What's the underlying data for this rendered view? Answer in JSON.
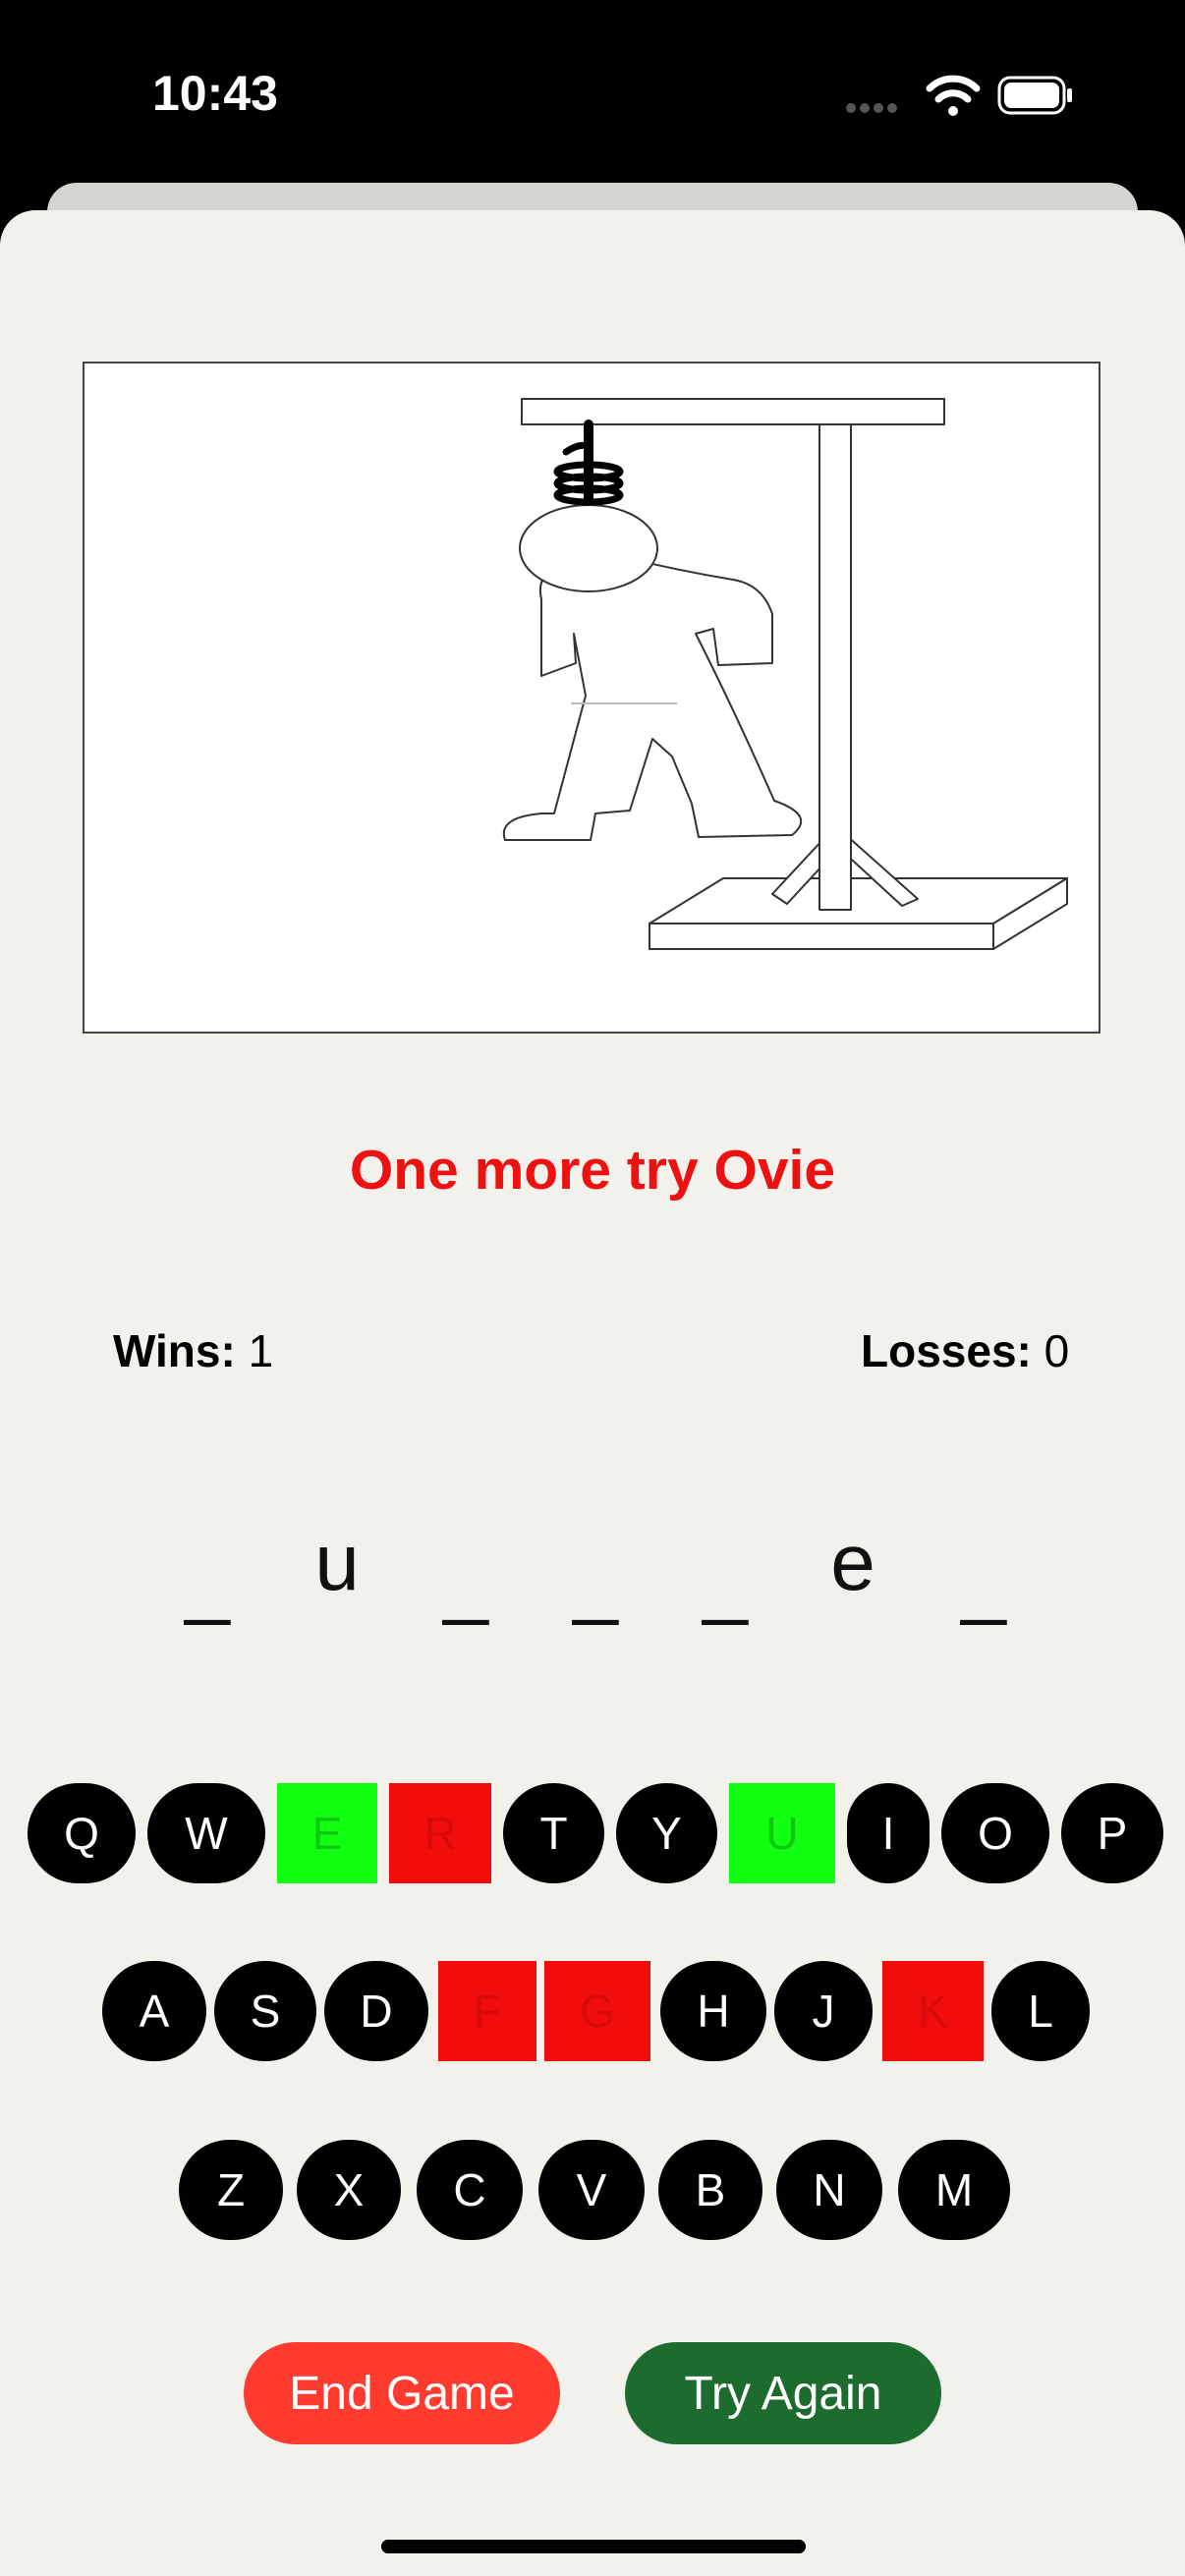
{
  "status_bar": {
    "time": "10:43"
  },
  "game": {
    "message": "One more try Ovie",
    "message_color": "#ee1111",
    "wins_label": "Wins:",
    "wins_value": "1",
    "losses_label": "Losses:",
    "losses_value": "0",
    "word_slots": [
      "_",
      "u",
      "_",
      "_",
      "_",
      "e",
      "_"
    ]
  },
  "keyboard": {
    "rows": [
      [
        {
          "letter": "Q",
          "state": "unused"
        },
        {
          "letter": "W",
          "state": "unused"
        },
        {
          "letter": "E",
          "state": "correct"
        },
        {
          "letter": "R",
          "state": "wrong"
        },
        {
          "letter": "T",
          "state": "unused"
        },
        {
          "letter": "Y",
          "state": "unused"
        },
        {
          "letter": "U",
          "state": "correct"
        },
        {
          "letter": "I",
          "state": "unused"
        },
        {
          "letter": "O",
          "state": "unused"
        },
        {
          "letter": "P",
          "state": "unused"
        }
      ],
      [
        {
          "letter": "A",
          "state": "unused"
        },
        {
          "letter": "S",
          "state": "unused"
        },
        {
          "letter": "D",
          "state": "unused"
        },
        {
          "letter": "F",
          "state": "wrong"
        },
        {
          "letter": "G",
          "state": "wrong"
        },
        {
          "letter": "H",
          "state": "unused"
        },
        {
          "letter": "J",
          "state": "unused"
        },
        {
          "letter": "K",
          "state": "wrong"
        },
        {
          "letter": "L",
          "state": "unused"
        }
      ],
      [
        {
          "letter": "Z",
          "state": "unused"
        },
        {
          "letter": "X",
          "state": "unused"
        },
        {
          "letter": "C",
          "state": "unused"
        },
        {
          "letter": "V",
          "state": "unused"
        },
        {
          "letter": "B",
          "state": "unused"
        },
        {
          "letter": "N",
          "state": "unused"
        },
        {
          "letter": "M",
          "state": "unused"
        }
      ]
    ]
  },
  "actions": {
    "end_game_label": "End Game",
    "end_game_color": "#ff3b30",
    "try_again_label": "Try Again",
    "try_again_color": "#1e6b30"
  },
  "icons": {
    "signal": "cellular-signal-icon",
    "wifi": "wifi-icon",
    "battery": "battery-icon",
    "hangman": "hangman-drawing"
  }
}
